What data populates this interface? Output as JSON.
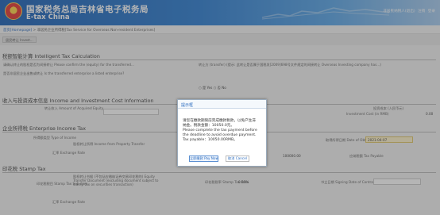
{
  "header": {
    "title_cn": "国家税务总局吉林省电子税务局",
    "title_en": "E-tax China",
    "links": [
      "非居民纳税人(退出)",
      "注销",
      "登录"
    ]
  },
  "breadcrumb": {
    "home": "首页[Homepage]",
    "separator": " > ",
    "current": "非居民企业所得税[Tax Service for Overseas Non-resident Enterprises]"
  },
  "page_tab": "居民转让 Invest...",
  "sections": {
    "calc_title": "税额智能计算 Intelligent Tax Calculation",
    "calc_row1_label": "请确认转让的股权是否为间接转让 Please confirm the (equity) for the transferred...",
    "calc_row1_right": "转让方 (transfer)  (提示: 此转让是否属于国税发[2009]698号文件规定的间接转让 Overseas Investing company has...)",
    "calc_row2_label": "是否非居民企业出售或转让 Is the transferred enterprise a listed enterprise?",
    "calc_row2_options": "○ 是 Yes  ○ 否 No",
    "income_title": "收入与投资成本信息 Income and Investment Cost Information",
    "income_left_label": "转让收入 Amount of Acquired Equity",
    "income_right_label1": "投资成本 (人民币元)",
    "income_right_label2": "Investment Cost (in RMB)",
    "income_right_val": "0.00",
    "eit_title": "企业所得税 Enterprise Income Tax",
    "eit_left_label1": "所得额类型 Type of Income",
    "eit_left_label2": "股权转让所得 Income from Property Transfer",
    "eit_right_label": "取得所得日期 Date of Obtaining Reported Income",
    "eit_right_val": "2021-04-07",
    "eit_row2_left": "汇率 Exchange Rate",
    "eit_row2_mid": "100000.00",
    "eit_row2_right": "应纳税额 Tax Payable",
    "stamp_title": "印花税 Stamp Tax",
    "stamp_left_label": "印花税税目 Stamp Tax Sub-item",
    "stamp_left_desc": "股权转让书据 (不包括应缴纳证券交易印花税的) Equity Transfer Document (excluding document subject to stamp tax on securities transaction)",
    "stamp_mid_label": "印花税税率 Stamp Tax Rate",
    "stamp_mid_val": "0.05%",
    "stamp_right_label": "书立日期 Signing Date of Contract",
    "stamp_row2_left": "汇率 Exchange Rate"
  },
  "modal": {
    "title": "提示框",
    "body_lines": [
      "请您在缴款期限前完成缴款税款，以免产生滞",
      "纳金。税款金额：10050.0元。",
      "Please complete the tax payment before",
      "the deadline to avoid overdue payment.",
      "Tax payable：10050.00RMB。"
    ],
    "ok_label": "立即缴款 Pay Now",
    "cancel_label": "取消 Cancel"
  }
}
